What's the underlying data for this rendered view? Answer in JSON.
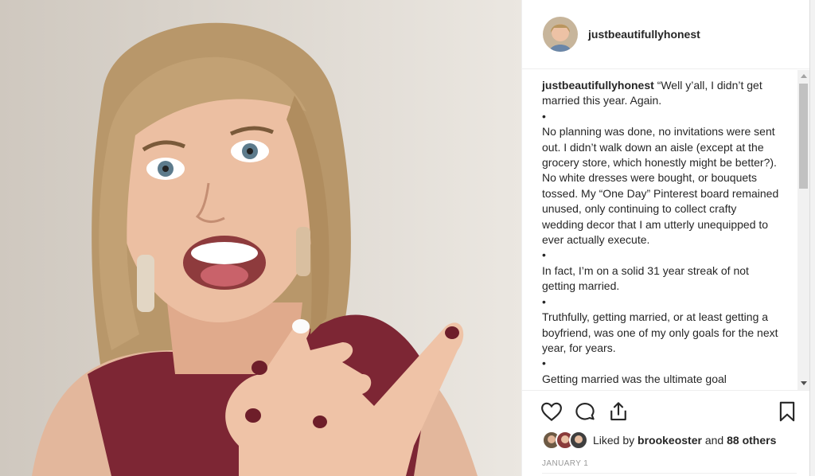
{
  "post": {
    "username": "justbeautifullyhonest",
    "caption": [
      "“Well y’all, I didn’t get married this year. Again.",
      "•",
      "No planning was done, no invitations were sent out. I didn’t walk down an aisle (except at the grocery store, which honestly might be better?). No white dresses were bought, or bouquets tossed. My “One Day” Pinterest board remained unused, only continuing to collect crafty wedding decor that I am utterly unequipped to ever actually execute.",
      "•",
      "In fact, I’m on a solid 31 year streak of not getting married.",
      "•",
      "Truthfully, getting married, or at least getting a boyfriend, was one of my only goals for the next year, for years.",
      "•",
      "Getting married was the ultimate goal"
    ],
    "liked_by_prefix": "Liked by",
    "liked_by_user": "brookeoster",
    "liked_by_and": "and",
    "liked_by_others": "88 others",
    "date": "JANUARY 1"
  },
  "icons": {
    "like": "heart-icon",
    "comment": "comment-icon",
    "share": "share-icon",
    "save": "bookmark-icon"
  },
  "colors": {
    "text": "#262626",
    "muted": "#999999",
    "border": "#efefef"
  }
}
